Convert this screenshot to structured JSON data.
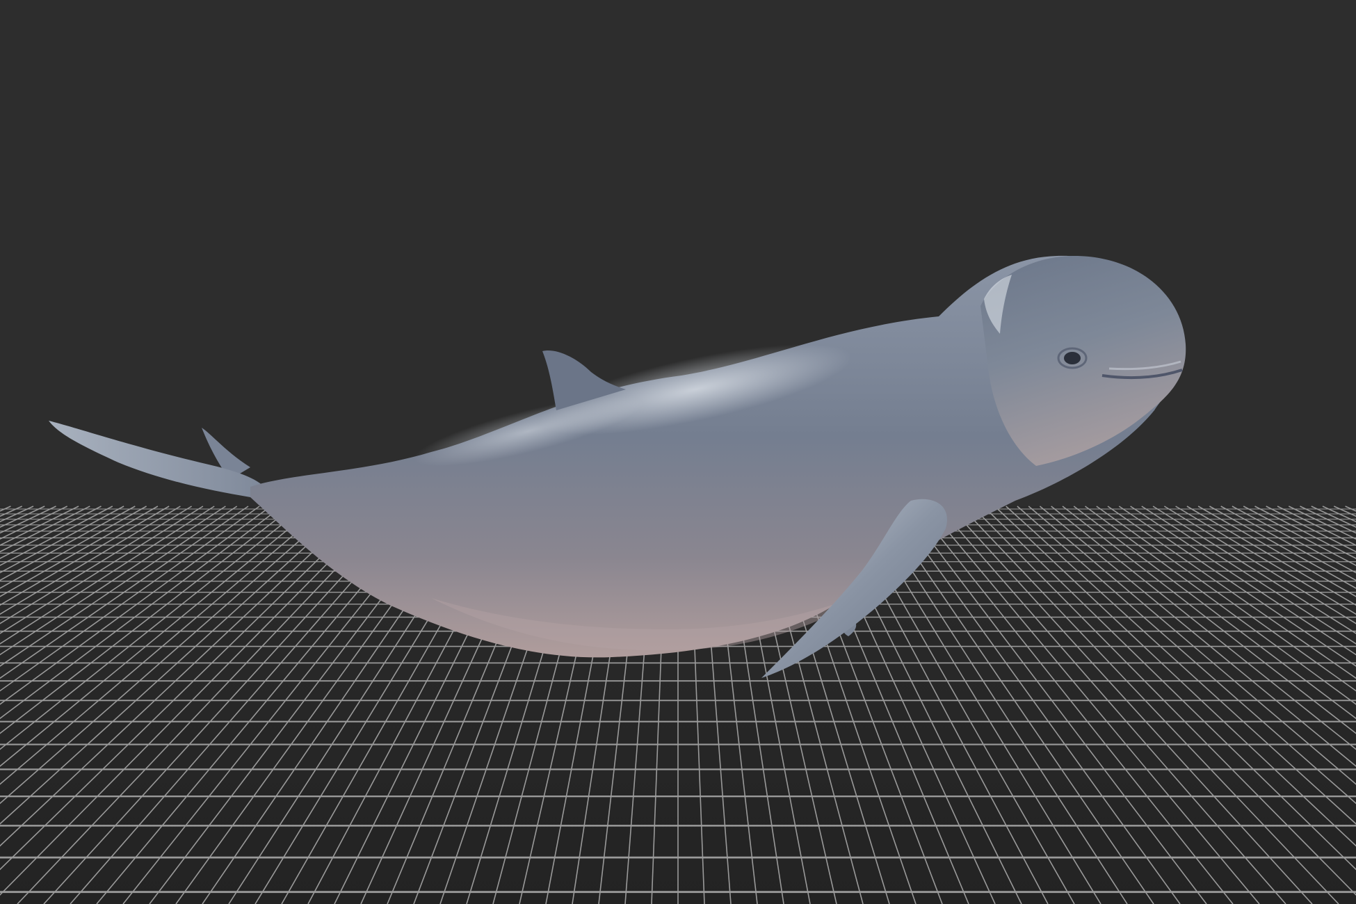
{
  "scene": {
    "background_color": "#2d2d2d",
    "floor": {
      "type": "perspective-grid",
      "line_color": "#9a9a9a",
      "floor_color": "#272727"
    },
    "model": {
      "subject": "whale",
      "body_color": "#7b8596",
      "belly_color": "#a89a9b",
      "highlight_color": "#d3dae3"
    }
  }
}
